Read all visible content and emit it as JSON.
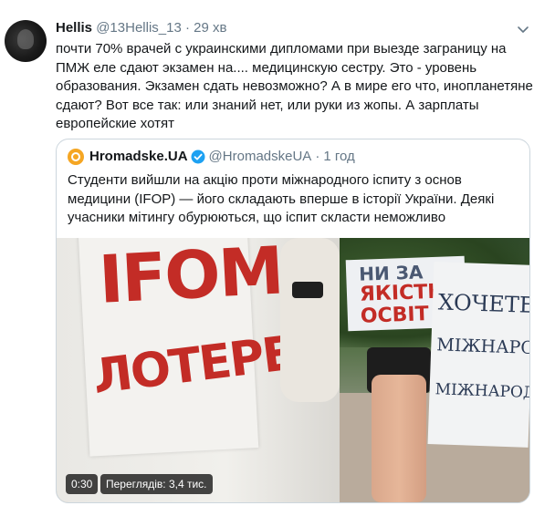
{
  "tweet": {
    "author_name": "Hellis",
    "author_handle": "@13Hellis_13",
    "separator": "·",
    "time": "29 хв",
    "text_lines": [
      "почти 70% врачей с украинскими дипломами при выезде заграницу на",
      "ПМЖ еле сдают экзамен на.... медицинскую сестру. Это - уровень",
      "образования. Экзамен сдать невозможно? А в мире его что, инопланетяне",
      "сдают? Вот все так: или знаний нет, или руки из жопы. А зарплаты",
      "европейские хотят"
    ],
    "menu_icon": "chevron-down-icon"
  },
  "quoted": {
    "name": "Hromadske.UA",
    "handle": "@HromadskeUA",
    "separator": "·",
    "time": "1 год",
    "text_lines": [
      "Студенти вийшли на акцію проти міжнародного іспиту з основ",
      "медицини (IFOP) — його складають вперше в історії України. Деякі",
      "учасники мітингу обурюються, що іспит скласти неможливо"
    ],
    "media": {
      "sign_left_line1": "IFOM",
      "sign_left_line2": "ЛОТЕРЕЯ",
      "sign_middle_lines": [
        "НИ ЗА",
        "ЯКІСТЬ",
        "ОСВІТ"
      ],
      "sign_right_lines": [
        "ХОЧЕТЕ",
        "МІЖНАРОД",
        "МІЖНАРОД"
      ],
      "duration": "0:30",
      "views": "Переглядів: 3,4 тис."
    }
  },
  "colors": {
    "text": "#14171a",
    "muted": "#657786",
    "verified": "#1da1f2",
    "sign_red": "#c32c26",
    "border": "#ccd6dd"
  }
}
